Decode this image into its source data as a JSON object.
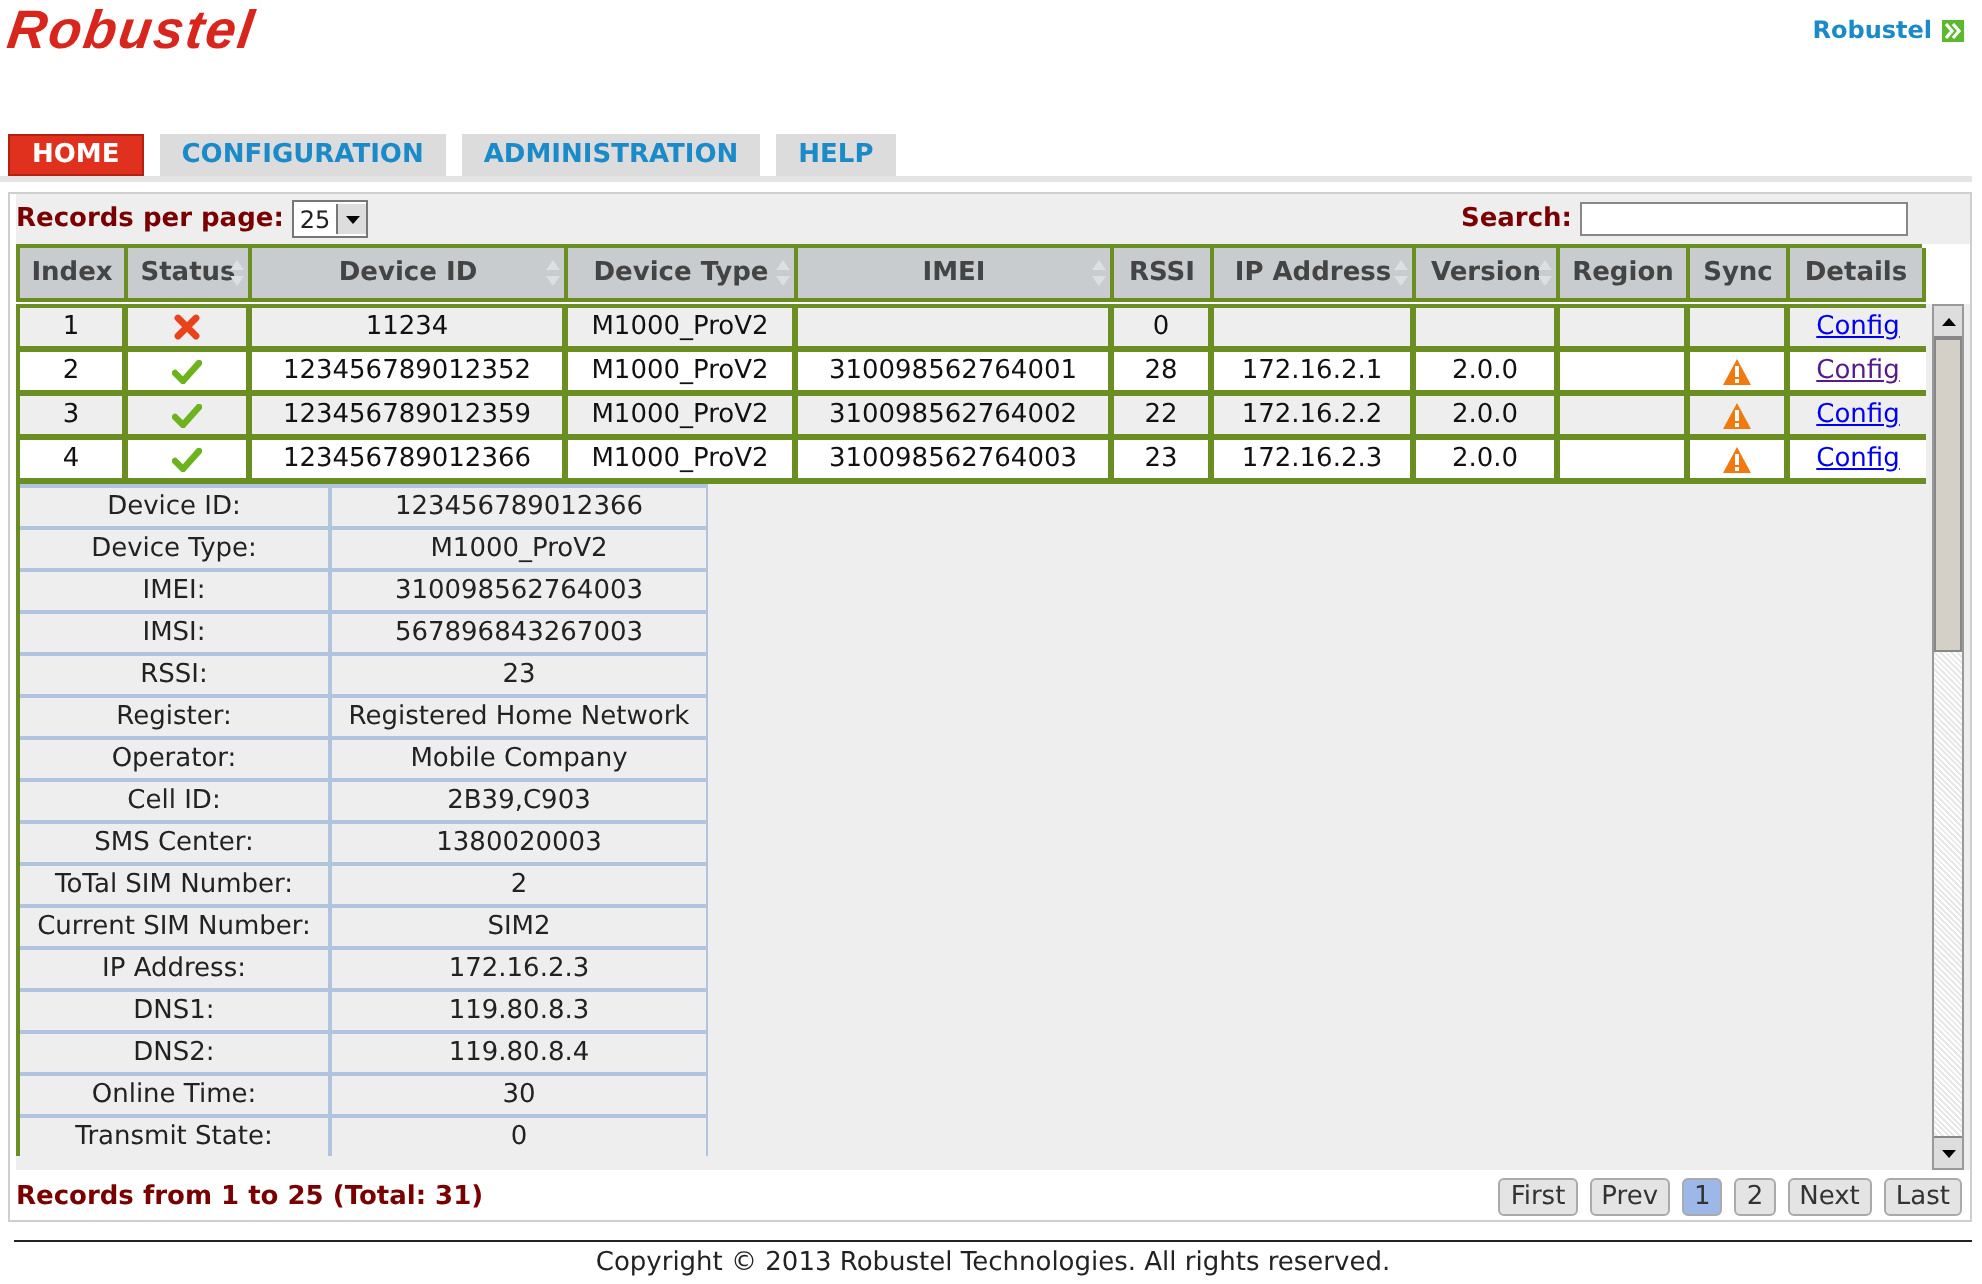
{
  "header": {
    "logo": "Robustel",
    "user_link": "Robustel"
  },
  "tabs": [
    {
      "label": "HOME",
      "selected": true
    },
    {
      "label": "CONFIGURATION",
      "selected": false
    },
    {
      "label": "ADMINISTRATION",
      "selected": false
    },
    {
      "label": "HELP",
      "selected": false
    }
  ],
  "toolbar": {
    "records_label": "Records per page:",
    "records_value": "25",
    "search_label": "Search:"
  },
  "table": {
    "columns": [
      {
        "label": "Index",
        "sortable": false
      },
      {
        "label": "Status",
        "sortable": true
      },
      {
        "label": "Device ID",
        "sortable": true
      },
      {
        "label": "Device Type",
        "sortable": true
      },
      {
        "label": "IMEI",
        "sortable": true
      },
      {
        "label": "RSSI",
        "sortable": false
      },
      {
        "label": "IP Address",
        "sortable": true
      },
      {
        "label": "Version",
        "sortable": true
      },
      {
        "label": "Region",
        "sortable": false
      },
      {
        "label": "Sync",
        "sortable": false
      },
      {
        "label": "Details",
        "sortable": false
      }
    ],
    "rows": [
      {
        "index": "1",
        "kind": "error",
        "device_id": "11234",
        "device_type": "M1000_ProV2",
        "imei": "",
        "rssi": "0",
        "ip": "",
        "version": "",
        "region": "",
        "sync_warning": false,
        "details": "Config",
        "visited": false
      },
      {
        "index": "2",
        "kind": "ok",
        "device_id": "123456789012352",
        "device_type": "M1000_ProV2",
        "imei": "310098562764001",
        "rssi": "28",
        "ip": "172.16.2.1",
        "version": "2.0.0",
        "region": "",
        "sync_warning": true,
        "details": "Config",
        "visited": true
      },
      {
        "index": "3",
        "kind": "ok",
        "device_id": "123456789012359",
        "device_type": "M1000_ProV2",
        "imei": "310098562764002",
        "rssi": "22",
        "ip": "172.16.2.2",
        "version": "2.0.0",
        "region": "",
        "sync_warning": true,
        "details": "Config",
        "visited": false
      },
      {
        "index": "4",
        "kind": "ok",
        "device_id": "123456789012366",
        "device_type": "M1000_ProV2",
        "imei": "310098562764003",
        "rssi": "23",
        "ip": "172.16.2.3",
        "version": "2.0.0",
        "region": "",
        "sync_warning": true,
        "details": "Config",
        "visited": false
      }
    ],
    "details": [
      {
        "label": "Device ID:",
        "value": "123456789012366"
      },
      {
        "label": "Device Type:",
        "value": "M1000_ProV2"
      },
      {
        "label": "IMEI:",
        "value": "310098562764003"
      },
      {
        "label": "IMSI:",
        "value": "567896843267003"
      },
      {
        "label": "RSSI:",
        "value": "23"
      },
      {
        "label": "Register:",
        "value": "Registered Home Network"
      },
      {
        "label": "Operator:",
        "value": "Mobile Company"
      },
      {
        "label": "Cell ID:",
        "value": "2B39,C903"
      },
      {
        "label": "SMS Center:",
        "value": "1380020003"
      },
      {
        "label": "ToTal SIM Number:",
        "value": "2"
      },
      {
        "label": "Current SIM Number:",
        "value": "SIM2"
      },
      {
        "label": "IP Address:",
        "value": "172.16.2.3"
      },
      {
        "label": "DNS1:",
        "value": "119.80.8.3"
      },
      {
        "label": "DNS2:",
        "value": "119.80.8.4"
      },
      {
        "label": "Online Time:",
        "value": "30"
      },
      {
        "label": "Transmit State:",
        "value": "0"
      }
    ]
  },
  "footer": {
    "records_info": "Records from 1 to 25 (Total: 31)",
    "pages": [
      {
        "label": "First",
        "selected": false
      },
      {
        "label": "Prev",
        "selected": false
      },
      {
        "label": "1",
        "selected": true
      },
      {
        "label": "2",
        "selected": false
      },
      {
        "label": "Next",
        "selected": false
      },
      {
        "label": "Last",
        "selected": false
      }
    ],
    "copyright": "Copyright © 2013 Robustel Technologies. All rights reserved."
  }
}
